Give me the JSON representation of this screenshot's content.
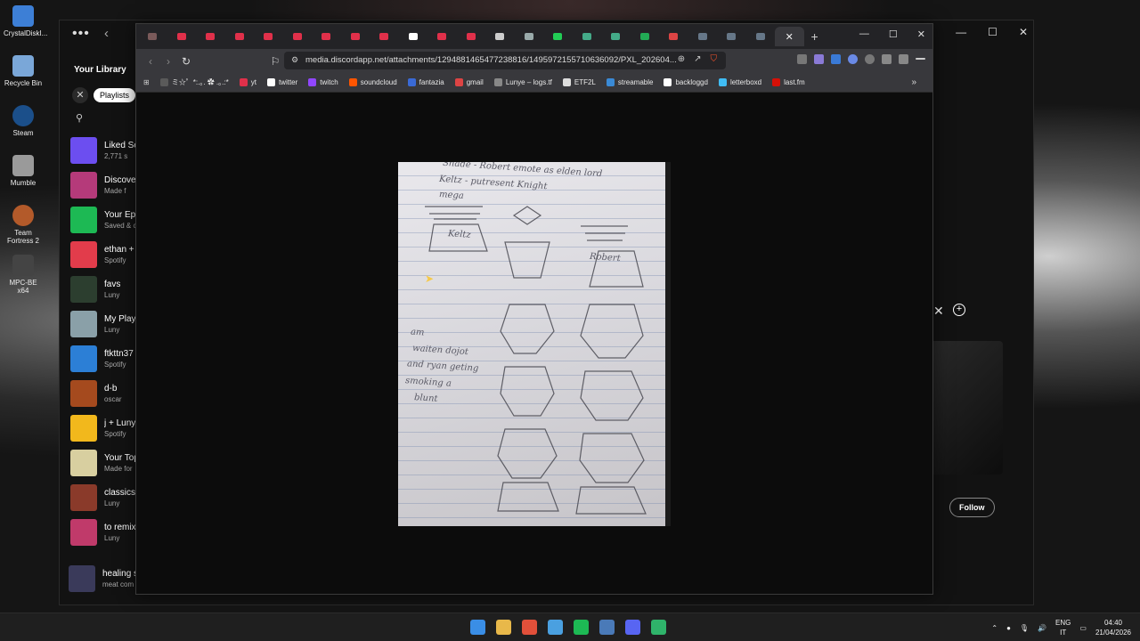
{
  "desktop": {
    "icons": [
      {
        "label": "CrystalDiskI...",
        "color": "#3d7fd6",
        "icon": "disk-icon"
      },
      {
        "label": "Recycle Bin",
        "color": "#7aa7d8",
        "icon": "recycle-bin-icon"
      },
      {
        "label": "Steam",
        "color": "#1b4f8a",
        "icon": "steam-icon"
      },
      {
        "label": "Mumble",
        "color": "#9a9a9a",
        "icon": "mumble-icon"
      },
      {
        "label": "Team Fortress 2",
        "color": "#b35a2a",
        "icon": "tf2-icon"
      },
      {
        "label": "MPC-BE x64",
        "color": "#444444",
        "icon": "mpc-icon"
      }
    ]
  },
  "spotify": {
    "library_title": "Your Library",
    "filter_chip": "Playlists",
    "playlists": [
      {
        "name": "Liked So",
        "sub": "2,771 s",
        "color": "#6c4ef0"
      },
      {
        "name": "Discover",
        "sub": "Made f",
        "color": "#b53a7a"
      },
      {
        "name": "Your Epi",
        "sub": "Saved & c",
        "color": "#1db954"
      },
      {
        "name": "ethan +",
        "sub": "Spotify",
        "color": "#e23c4b"
      },
      {
        "name": "favs",
        "sub": "Luny",
        "color": "#2c3e2f"
      },
      {
        "name": "My Playl",
        "sub": "Luny",
        "color": "#8aa0a8"
      },
      {
        "name": "ftkttn37",
        "sub": "Spotify",
        "color": "#2c7fd6"
      },
      {
        "name": "d-b",
        "sub": "oscar",
        "color": "#a54a1e"
      },
      {
        "name": "j + Luny",
        "sub": "Spotify",
        "color": "#f2b81c"
      },
      {
        "name": "Your Top",
        "sub": "Made for",
        "color": "#d8cfa0"
      },
      {
        "name": "classics",
        "sub": "Luny",
        "color": "#8a3a2a"
      },
      {
        "name": "to remix",
        "sub": "Luny",
        "color": "#c03a6a"
      }
    ],
    "now_playing": {
      "title": "healing s",
      "artist": "meat com"
    },
    "follow_label": "Follow"
  },
  "browser": {
    "tab_favicon_colors": [
      "#7a5a5a",
      "#e0304a",
      "#e0304a",
      "#e0304a",
      "#e0304a",
      "#e0304a",
      "#e0304a",
      "#e0304a",
      "#e0304a",
      "#ffffff",
      "#e0304a",
      "#e0304a",
      "#cccccc",
      "#9aa",
      "#22cc55",
      "#44aa88",
      "#44aa88",
      "#22aa55",
      "#dd4444",
      "#667788",
      "#667788",
      "#667788"
    ],
    "active_tab_close": "✕",
    "new_tab": "+",
    "url": "media.discordapp.net/attachments/1294881465477238816/1495972155710636092/PXL_202604...",
    "bookmarks": [
      {
        "label": "ミ☆゜*:.｡. ✿ .｡.:*",
        "color": "#5a5a5a"
      },
      {
        "label": "yt",
        "color": "#e0304a"
      },
      {
        "label": "twitter",
        "color": "#ffffff"
      },
      {
        "label": "twitch",
        "color": "#9146ff"
      },
      {
        "label": "soundcloud",
        "color": "#ff5500"
      },
      {
        "label": "fantazia",
        "color": "#3a6ad6"
      },
      {
        "label": "gmail",
        "color": "#dd4444"
      },
      {
        "label": "Lunye – logs.tf",
        "color": "#888888"
      },
      {
        "label": "ETF2L",
        "color": "#dddddd"
      },
      {
        "label": "streamable",
        "color": "#3a8ad6"
      },
      {
        "label": "backloggd",
        "color": "#ffffff"
      },
      {
        "label": "letterboxd",
        "color": "#40bcf4"
      },
      {
        "label": "last.fm",
        "color": "#d51007"
      }
    ],
    "bookmarks_more": "»"
  },
  "photo_text": {
    "line1": "Shade - Robert emote as elden lord",
    "line2": "Keltz - putresent Knight",
    "line3": "mega",
    "left_label": "Keltz",
    "right_label": "Robert",
    "note1": "am",
    "note2": "waiten dojot",
    "note3": "and ryan geting",
    "note4": "smoking a",
    "note5": "blunt"
  },
  "taskbar": {
    "app_colors": [
      "#3a8ee6",
      "#e8b84a",
      "#e2503a",
      "#4aa0e0",
      "#1db954",
      "#4a7ab8",
      "#5865f2",
      "#2fb36a"
    ],
    "lang_top": "ENG",
    "lang_bottom": "IT",
    "time": "04:40",
    "date": "21/04/2026"
  }
}
